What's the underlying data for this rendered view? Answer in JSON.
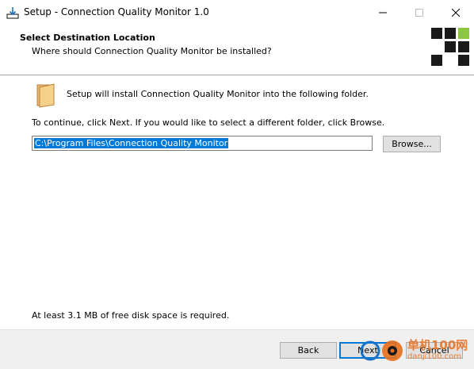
{
  "window": {
    "title": "Setup - Connection Quality Monitor 1.0"
  },
  "header": {
    "title": "Select Destination Location",
    "subtitle": "Where should Connection Quality Monitor be installed?"
  },
  "main": {
    "install_text": "Setup will install Connection Quality Monitor into the following folder.",
    "continue_text": "To continue, click Next. If you would like to select a different folder, click Browse.",
    "path_value": "C:\\Program Files\\Connection Quality Monitor",
    "browse_label": "Browse...",
    "space_text": "At least 3.1 MB of free disk space is required."
  },
  "footer": {
    "back_label": "Back",
    "next_label": "Next",
    "cancel_label": "Cancel"
  },
  "watermark": {
    "line1": "单机100网",
    "line2": "danji100.com"
  },
  "colors": {
    "accent": "#0078d7",
    "logo_green": "#8dc63f",
    "logo_dark": "#1a1a1a",
    "watermark": "#e76f1b"
  },
  "icons": {
    "app": "installer-download-icon",
    "folder": "folder-icon"
  }
}
